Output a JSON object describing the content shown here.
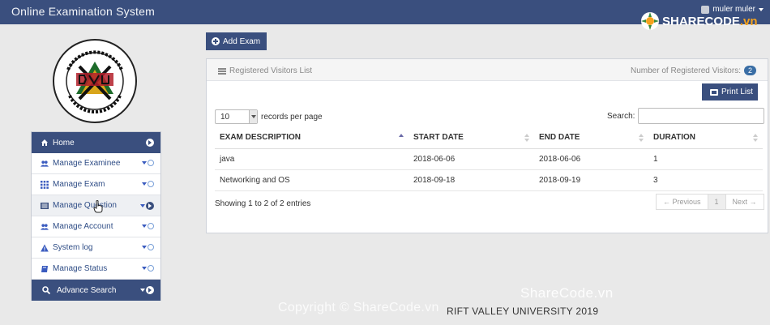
{
  "header": {
    "app_title": "Online Examination System",
    "user_name": "muler muler"
  },
  "logo": {
    "top_text": "ሪፍት ቫሊ ዩኒቨርሲቲ",
    "bottom_text": "RIFT VALLEY UNIVERSITY",
    "center_text": "RVU"
  },
  "sidebar": {
    "items": [
      {
        "label": "Home",
        "icon": "home-icon"
      },
      {
        "label": "Manage Examinee",
        "icon": "users-icon"
      },
      {
        "label": "Manage Exam",
        "icon": "grid-icon"
      },
      {
        "label": "Manage Question",
        "icon": "list-icon"
      },
      {
        "label": "Manage Account",
        "icon": "users-icon"
      },
      {
        "label": "System log",
        "icon": "warning-icon"
      },
      {
        "label": "Manage Status",
        "icon": "book-icon"
      },
      {
        "label": "Advance Search",
        "icon": "search-icon"
      }
    ]
  },
  "main": {
    "add_exam_label": "Add Exam",
    "panel_title": "Registered Visitors List",
    "visitors_label": "Number of Registered Visitors:",
    "visitors_count": "2",
    "print_label": "Print List",
    "page_length": "10",
    "records_per_page_label": "records per page",
    "search_label": "Search:",
    "search_value": "",
    "columns": [
      "EXAM DESCRIPTION",
      "START DATE",
      "END DATE",
      "DURATION"
    ],
    "rows": [
      [
        "java",
        "2018-06-06",
        "2018-06-06",
        "1"
      ],
      [
        "Networking and OS",
        "2018-09-18",
        "2018-09-19",
        "3"
      ]
    ],
    "info": "Showing 1 to 2 of 2 entries",
    "pagination": {
      "previous": "← Previous",
      "page": "1",
      "next": "Next →"
    }
  },
  "footer": {
    "text": "RIFT VALLEY UNIVERSITY 2019"
  },
  "watermark": {
    "logo_text_main": "SHARECODE",
    "logo_text_suffix": ".vn",
    "mid": "ShareCode.vn",
    "copyright": "Copyright © ShareCode.vn"
  },
  "colors": {
    "navy": "#3a4f7e",
    "accent": "#3a5bbf",
    "page_bg": "#e9e9e9"
  }
}
